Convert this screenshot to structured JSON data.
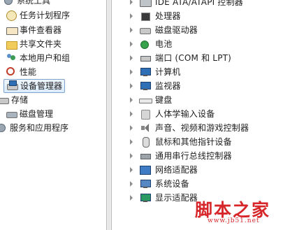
{
  "left_tree": {
    "items": [
      {
        "label": "系统工具",
        "icon": "tools-icon",
        "selected": false
      },
      {
        "label": "任务计划程序",
        "icon": "clock-icon",
        "selected": false
      },
      {
        "label": "事件查看器",
        "icon": "event-viewer-icon",
        "selected": false
      },
      {
        "label": "共享文件夹",
        "icon": "shared-folder-icon",
        "selected": false
      },
      {
        "label": "本地用户和组",
        "icon": "users-icon",
        "selected": false
      },
      {
        "label": "性能",
        "icon": "performance-icon",
        "selected": false
      },
      {
        "label": "设备管理器",
        "icon": "device-manager-icon",
        "selected": true
      },
      {
        "label": "存储",
        "icon": "storage-icon",
        "selected": false
      },
      {
        "label": "磁盘管理",
        "icon": "disk-management-icon",
        "selected": false
      },
      {
        "label": "服务和应用程序",
        "icon": "services-icon",
        "selected": false
      }
    ]
  },
  "device_tree": {
    "items": [
      {
        "label": "IDE ATA/ATAPI 控制器",
        "icon": "ide-controller-icon"
      },
      {
        "label": "处理器",
        "icon": "processor-icon"
      },
      {
        "label": "磁盘驱动器",
        "icon": "disk-drive-icon"
      },
      {
        "label": "电池",
        "icon": "battery-icon"
      },
      {
        "label": "端口 (COM 和 LPT)",
        "icon": "port-icon"
      },
      {
        "label": "计算机",
        "icon": "computer-icon"
      },
      {
        "label": "监视器",
        "icon": "monitor-icon"
      },
      {
        "label": "键盘",
        "icon": "keyboard-icon"
      },
      {
        "label": "人体学输入设备",
        "icon": "hid-icon"
      },
      {
        "label": "声音、视频和游戏控制器",
        "icon": "sound-icon"
      },
      {
        "label": "鼠标和其他指针设备",
        "icon": "mouse-icon"
      },
      {
        "label": "通用串行总线控制器",
        "icon": "usb-icon"
      },
      {
        "label": "网络适配器",
        "icon": "network-adapter-icon"
      },
      {
        "label": "系统设备",
        "icon": "system-device-icon"
      },
      {
        "label": "显示适配器",
        "icon": "display-adapter-icon"
      }
    ]
  },
  "watermark": {
    "title": "脚本之家",
    "url": "www.jb51.net",
    "color": "#d7262a"
  },
  "colors": {
    "selection_border": "#7da2ce",
    "selection_fill": "#dcecfb",
    "text": "#1e1e1e"
  }
}
